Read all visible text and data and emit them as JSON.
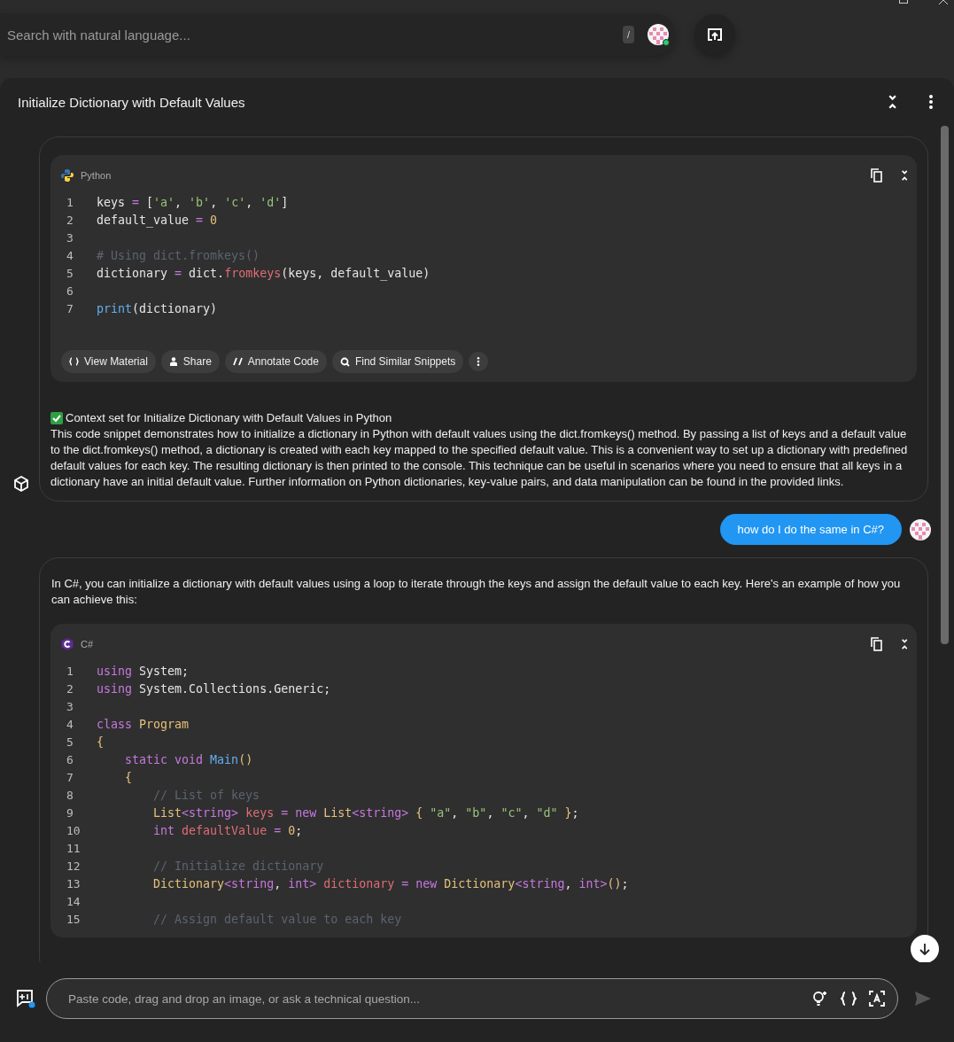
{
  "search": {
    "placeholder": "Search with natural language...",
    "shortcut": "/"
  },
  "conversation": {
    "title": "Initialize Dictionary with Default Values"
  },
  "messages": [
    {
      "kind": "bot",
      "code": {
        "language": "Python",
        "lines": [
          {
            "number": "1",
            "tokens": [
              {
                "kind": "p",
                "text": "keys "
              },
              {
                "kind": "o",
                "text": "="
              },
              {
                "kind": "p",
                "text": " ["
              },
              {
                "kind": "s",
                "text": "'a'"
              },
              {
                "kind": "p",
                "text": ", "
              },
              {
                "kind": "s",
                "text": "'b'"
              },
              {
                "kind": "p",
                "text": ", "
              },
              {
                "kind": "s",
                "text": "'c'"
              },
              {
                "kind": "p",
                "text": ", "
              },
              {
                "kind": "s",
                "text": "'d'"
              },
              {
                "kind": "p",
                "text": "]"
              }
            ]
          },
          {
            "number": "2",
            "tokens": [
              {
                "kind": "p",
                "text": "default_value "
              },
              {
                "kind": "o",
                "text": "="
              },
              {
                "kind": "n",
                "text": " 0"
              }
            ]
          },
          {
            "number": "3"
          },
          {
            "number": "4",
            "tokens": [
              {
                "kind": "c",
                "text": "# Using dict.fromkeys()"
              }
            ]
          },
          {
            "number": "5",
            "tokens": [
              {
                "kind": "p",
                "text": "dictionary "
              },
              {
                "kind": "o",
                "text": "="
              },
              {
                "kind": "p",
                "text": " dict."
              },
              {
                "kind": "f",
                "text": "fromkeys"
              },
              {
                "kind": "p",
                "text": "(keys, default_value)"
              }
            ]
          },
          {
            "number": "6"
          },
          {
            "number": "7",
            "tokens": [
              {
                "kind": "b",
                "text": "print"
              },
              {
                "kind": "p",
                "text": "(dictionary)"
              }
            ]
          }
        ],
        "actions": [
          "View Material",
          "Share",
          "Annotate Code",
          "Find Similar Snippets"
        ]
      },
      "context": "Context set for Initialize Dictionary with Default Values in Python",
      "text": "This code snippet demonstrates how to initialize a dictionary in Python with default values using the dict.fromkeys() method. By passing a list of keys and a default value to the dict.fromkeys() method, a dictionary is created with each key mapped to the specified default value. This is a convenient way to set up a dictionary with predefined default values for each key. The resulting dictionary is then printed to the console. This technique can be useful in scenarios where you need to ensure that all keys in a dictionary have an initial default value. Further information on Python dictionaries, key-value pairs, and data manipulation can be found in the provided links."
    },
    {
      "kind": "user",
      "text": "how do I do the same in C#?"
    },
    {
      "kind": "bot",
      "text": "In C#, you can initialize a dictionary with default values using a loop to iterate through the keys and assign the default value to each key. Here's an example of how you can achieve this:",
      "code": {
        "language": "C#",
        "lines": [
          {
            "number": "1",
            "tokens": [
              {
                "kind": "k",
                "text": "using"
              },
              {
                "kind": "p",
                "text": " System;"
              }
            ]
          },
          {
            "number": "2",
            "tokens": [
              {
                "kind": "k",
                "text": "using"
              },
              {
                "kind": "p",
                "text": " System.Collections.Generic;"
              }
            ]
          },
          {
            "number": "3"
          },
          {
            "number": "4",
            "tokens": [
              {
                "kind": "k",
                "text": "class"
              },
              {
                "kind": "t",
                "text": " Program"
              }
            ]
          },
          {
            "number": "5",
            "tokens": [
              {
                "kind": "t",
                "text": "{"
              }
            ]
          },
          {
            "number": "6",
            "tokens": [
              {
                "kind": "k",
                "text": "    static void"
              },
              {
                "kind": "b",
                "text": " Main"
              },
              {
                "kind": "t",
                "text": "()"
              }
            ]
          },
          {
            "number": "7",
            "tokens": [
              {
                "kind": "t",
                "text": "    {"
              }
            ]
          },
          {
            "number": "8",
            "tokens": [
              {
                "kind": "c",
                "text": "        // List of keys"
              }
            ]
          },
          {
            "number": "9",
            "tokens": [
              {
                "kind": "t",
                "text": "        List"
              },
              {
                "kind": "k",
                "text": "<string>"
              },
              {
                "kind": "v",
                "text": " keys"
              },
              {
                "kind": "o",
                "text": " ="
              },
              {
                "kind": "k",
                "text": " new"
              },
              {
                "kind": "t",
                "text": " List"
              },
              {
                "kind": "k",
                "text": "<string>"
              },
              {
                "kind": "t",
                "text": " {"
              },
              {
                "kind": "s",
                "text": " \"a\""
              },
              {
                "kind": "p",
                "text": ", "
              },
              {
                "kind": "s",
                "text": "\"b\""
              },
              {
                "kind": "p",
                "text": ", "
              },
              {
                "kind": "s",
                "text": "\"c\""
              },
              {
                "kind": "p",
                "text": ", "
              },
              {
                "kind": "s",
                "text": "\"d\""
              },
              {
                "kind": "t",
                "text": " }"
              },
              {
                "kind": "p",
                "text": ";"
              }
            ]
          },
          {
            "number": "10",
            "tokens": [
              {
                "kind": "k",
                "text": "        int"
              },
              {
                "kind": "v",
                "text": " defaultValue"
              },
              {
                "kind": "o",
                "text": " ="
              },
              {
                "kind": "n",
                "text": " 0"
              },
              {
                "kind": "p",
                "text": ";"
              }
            ]
          },
          {
            "number": "11"
          },
          {
            "number": "12",
            "tokens": [
              {
                "kind": "c",
                "text": "        // Initialize dictionary"
              }
            ]
          },
          {
            "number": "13",
            "tokens": [
              {
                "kind": "t",
                "text": "        Dictionary"
              },
              {
                "kind": "k",
                "text": "<string"
              },
              {
                "kind": "p",
                "text": ", "
              },
              {
                "kind": "k",
                "text": "int>"
              },
              {
                "kind": "v",
                "text": " dictionary"
              },
              {
                "kind": "o",
                "text": " ="
              },
              {
                "kind": "k",
                "text": " new"
              },
              {
                "kind": "t",
                "text": " Dictionary"
              },
              {
                "kind": "k",
                "text": "<string"
              },
              {
                "kind": "p",
                "text": ", "
              },
              {
                "kind": "k",
                "text": "int>"
              },
              {
                "kind": "t",
                "text": "()"
              },
              {
                "kind": "p",
                "text": ";"
              }
            ]
          },
          {
            "number": "14"
          },
          {
            "number": "15",
            "tokens": [
              {
                "kind": "c",
                "text": "        // Assign default value to each key"
              }
            ]
          }
        ]
      }
    }
  ],
  "composer": {
    "placeholder": "Paste code, drag and drop an image, or ask a technical question..."
  }
}
